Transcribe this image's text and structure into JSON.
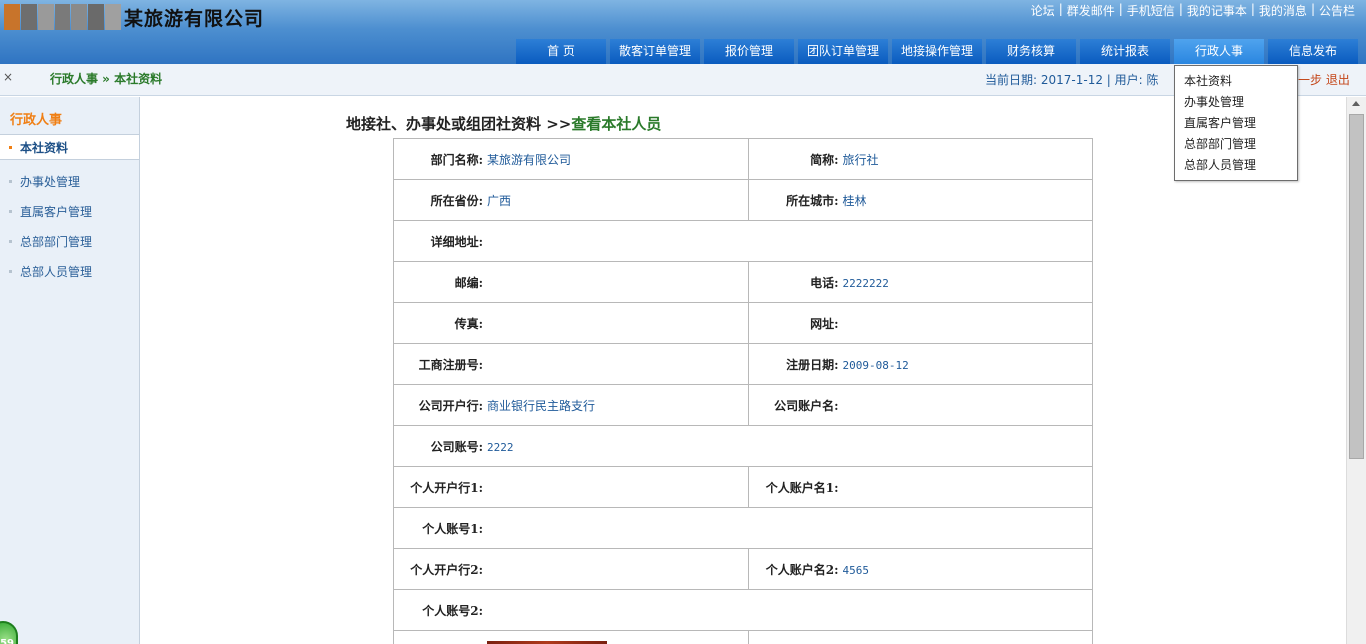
{
  "app": {
    "company_name": "某旅游有限公司",
    "top_links": [
      "论坛",
      "群发邮件",
      "手机短信",
      "我的记事本",
      "我的消息",
      "公告栏"
    ],
    "nav_tabs": [
      {
        "label": "首 页",
        "active": false
      },
      {
        "label": "散客订单管理",
        "active": false
      },
      {
        "label": "报价管理",
        "active": false
      },
      {
        "label": "团队订单管理",
        "active": false
      },
      {
        "label": "地接操作管理",
        "active": false
      },
      {
        "label": "财务核算",
        "active": false
      },
      {
        "label": "统计报表",
        "active": false
      },
      {
        "label": "行政人事",
        "active": true
      },
      {
        "label": "信息发布",
        "active": false
      }
    ],
    "logo_colors": [
      "#c8742b",
      "#6e6e6e",
      "#9a9a9a",
      "#7a7a7a",
      "#8a8a8a",
      "#6a6a6a",
      "#a0a0a0"
    ]
  },
  "crumb": {
    "close": "×",
    "path": "行政人事 » 本社资料",
    "status": "当前日期: 2017-1-12 | 用户: 陈",
    "right": "一步 退出"
  },
  "dropdown": {
    "items": [
      "本社资料",
      "办事处管理",
      "直属客户管理",
      "总部部门管理",
      "总部人员管理"
    ]
  },
  "sidebar": {
    "title": "行政人事",
    "items": [
      {
        "label": "本社资料",
        "active": true
      },
      {
        "label": "办事处管理",
        "active": false
      },
      {
        "label": "直属客户管理",
        "active": false
      },
      {
        "label": "总部部门管理",
        "active": false
      },
      {
        "label": "总部人员管理",
        "active": false
      }
    ],
    "badge": "59"
  },
  "content": {
    "title": "地接社、办事处或组团社资料 >>",
    "title_link": "查看本社人员",
    "rows": [
      {
        "l_label": "部门名称:",
        "l_value": "某旅游有限公司",
        "r_label": "简称:",
        "r_value": "旅行社"
      },
      {
        "l_label": "所在省份:",
        "l_value": "广西",
        "r_label": "所在城市:",
        "r_value": "桂林"
      },
      {
        "l_label": "详细地址:",
        "l_value": "",
        "full": true
      },
      {
        "l_label": "邮编:",
        "l_value": "",
        "r_label": "电话:",
        "r_value": "2222222"
      },
      {
        "l_label": "传真:",
        "l_value": "",
        "r_label": "网址:",
        "r_value": ""
      },
      {
        "l_label": "工商注册号:",
        "l_value": "",
        "r_label": "注册日期:",
        "r_value": "2009-08-12"
      },
      {
        "l_label": "公司开户行:",
        "l_value": "商业银行民主路支行",
        "r_label": "公司账户名:",
        "r_value": ""
      },
      {
        "l_label": "公司账号:",
        "l_value": "2222",
        "full": true
      },
      {
        "l_label": "个人开户行1:",
        "l_value": "",
        "r_label": "个人账户名1:",
        "r_value": ""
      },
      {
        "l_label": "个人账号1:",
        "l_value": "",
        "full": true
      },
      {
        "l_label": "个人开户行2:",
        "l_value": "",
        "r_label": "个人账户名2:",
        "r_value": "4565"
      },
      {
        "l_label": "个人账号2:",
        "l_value": "",
        "full": true
      },
      {
        "l_label": "",
        "l_value": "",
        "r_label": "",
        "r_value": "",
        "has_image": true
      }
    ]
  }
}
